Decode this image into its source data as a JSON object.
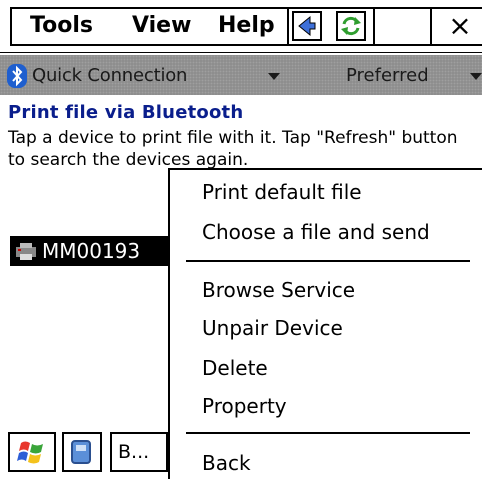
{
  "menubar": {
    "tools_label": "Tools",
    "view_label": "View",
    "help_label": "Help",
    "close_label": "×"
  },
  "toolbar": {
    "connection_label": "Quick Connection",
    "preferred_label": "Preferred"
  },
  "content": {
    "title": "Print file via Bluetooth",
    "description": "Tap a device to print file with it. Tap \"Refresh\" button to search the devices again."
  },
  "device": {
    "name": "MM00193"
  },
  "taskbar": {
    "task_label": "B..."
  },
  "context_menu": {
    "items": [
      "Print default file",
      "Choose a file and send",
      "Browse Service",
      "Unpair Device",
      "Delete",
      "Property",
      "Back"
    ]
  },
  "colors": {
    "title": "#0a1e8c",
    "toolbar": "#8a8a8a",
    "bluetooth": "#1f5fcf",
    "refresh": "#2f9e2f"
  }
}
